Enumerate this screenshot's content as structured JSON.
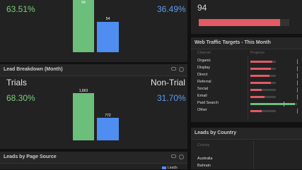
{
  "top_left": {
    "left_pct": "63.51%",
    "right_pct": "36.49%",
    "left_bar_value": "94",
    "right_bar_value": "54"
  },
  "top_right": {
    "value": "94",
    "progress": 0.9
  },
  "lead_breakdown": {
    "title": "Lead Breakdown (Month)",
    "left_label": "Trials",
    "right_label": "Non-Trial",
    "left_pct": "68.30%",
    "right_pct": "31.70%",
    "left_bar_value": "1,663",
    "right_bar_value": "772"
  },
  "web_traffic": {
    "title": "Web Traffic Targets - This Month",
    "col_channel": "Channel",
    "col_progress": "Progress",
    "rows": [
      {
        "label": "Organic",
        "progress": 0.85,
        "color": "#e15a66"
      },
      {
        "label": "Display",
        "progress": 0.8,
        "color": "#e15a66"
      },
      {
        "label": "Direct",
        "progress": 0.75,
        "color": "#e15a66"
      },
      {
        "label": "Referral",
        "progress": 0.8,
        "color": "#e15a66"
      },
      {
        "label": "Social",
        "progress": 0.45,
        "color": "#e15a66"
      },
      {
        "label": "Email",
        "progress": 0.55,
        "color": "#e15a66"
      },
      {
        "label": "Paid Search",
        "progress": 0.95,
        "color": "#6cbf7a"
      },
      {
        "label": "Other",
        "progress": 0.45,
        "color": "#e15a66"
      }
    ]
  },
  "leads_by_country": {
    "title": "Leads by Country",
    "col_country": "Country",
    "rows": [
      "Australia",
      "Bahrain"
    ]
  },
  "leads_by_page_source": {
    "title": "Leads by Page Source",
    "legend": "Leads"
  }
}
